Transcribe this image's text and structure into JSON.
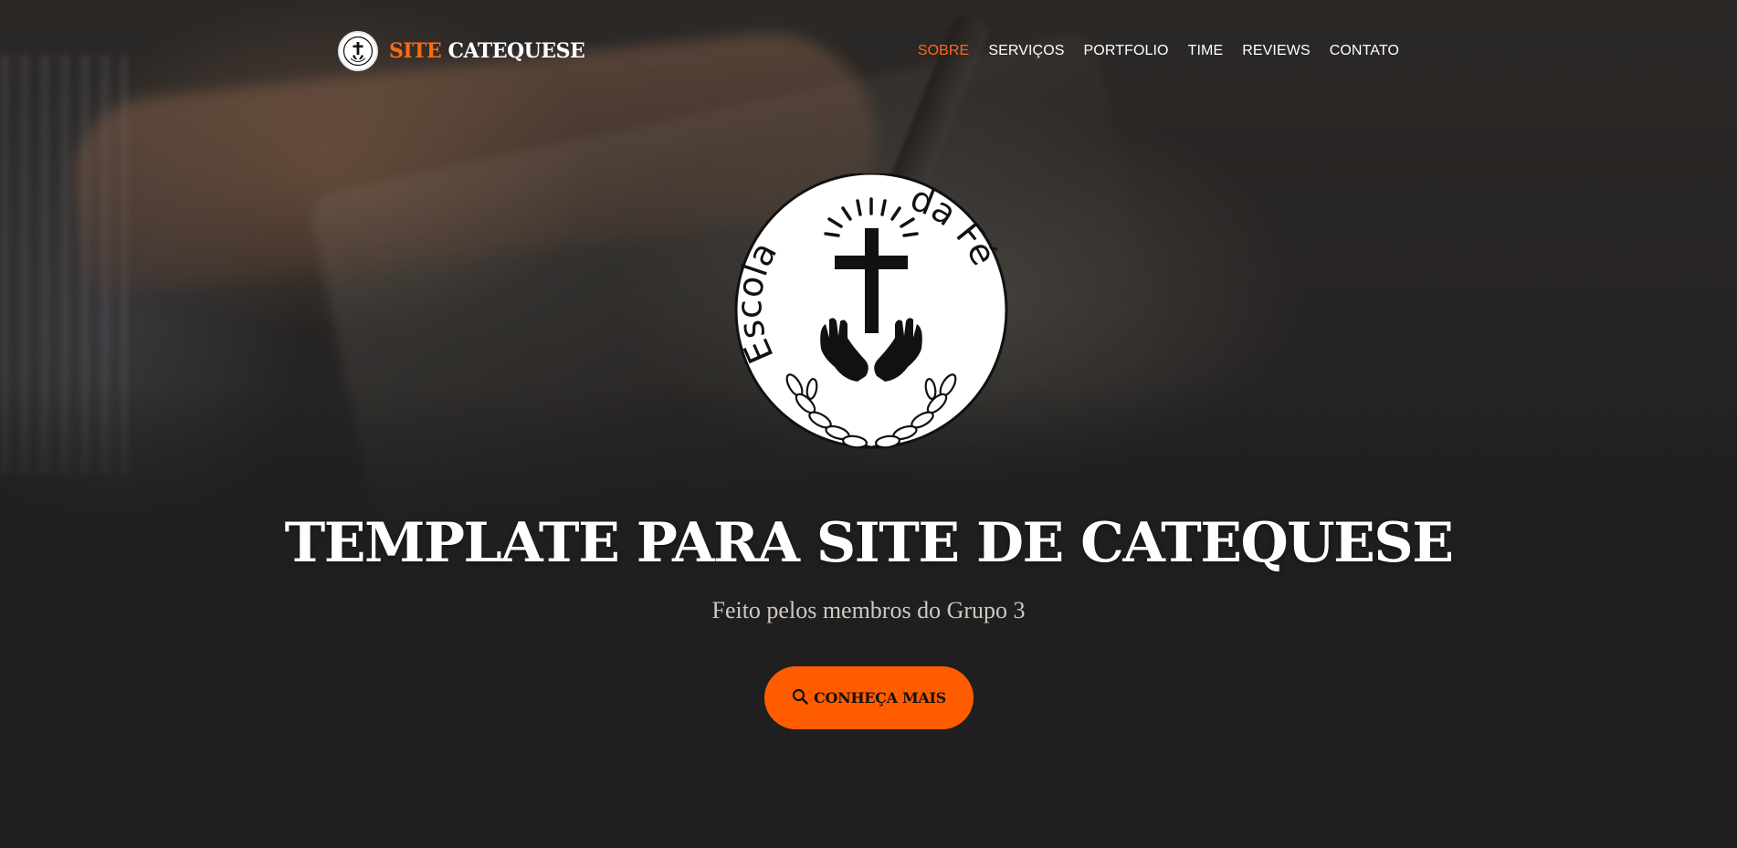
{
  "brand": {
    "accent_word": "SITE",
    "rest_word": "CATEQUESE",
    "logo_icon": "cross-hands-emblem-icon"
  },
  "nav": {
    "items": [
      {
        "label": "SOBRE",
        "active": true
      },
      {
        "label": "SERVIÇOS",
        "active": false
      },
      {
        "label": "PORTFOLIO",
        "active": false
      },
      {
        "label": "TIME",
        "active": false
      },
      {
        "label": "REVIEWS",
        "active": false
      },
      {
        "label": "CONTATO",
        "active": false
      }
    ]
  },
  "emblem": {
    "text_left": "Escola",
    "text_right": "da Fé",
    "icon": "cross-praying-hands-laurel-icon"
  },
  "hero": {
    "title": "TEMPLATE PARA SITE DE CATEQUESE",
    "subtitle": "Feito pelos membros do Grupo 3",
    "cta_label": "CONHEÇA MAIS",
    "cta_icon": "search-icon"
  },
  "colors": {
    "accent": "#ff6a13",
    "button": "#ff5c00",
    "background": "#1f1f1f",
    "text": "#ffffff",
    "subtitle": "#cfc9c2"
  }
}
